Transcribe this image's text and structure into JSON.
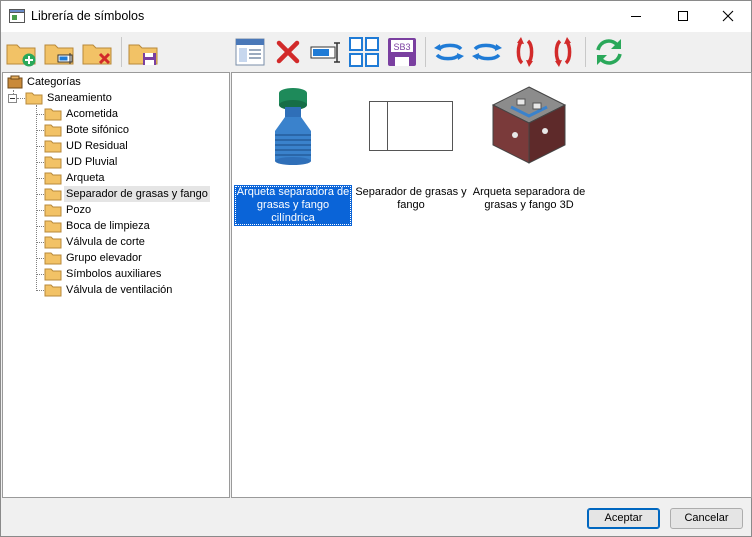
{
  "window": {
    "title": "Librería de símbolos"
  },
  "tree": {
    "root": "Categorías",
    "group": "Saneamiento",
    "items": [
      "Acometida",
      "Bote sifónico",
      "UD Residual",
      "UD Pluvial",
      "Arqueta",
      "Separador de grasas y fango",
      "Pozo",
      "Boca de limpieza",
      "Válvula de corte",
      "Grupo elevador",
      "Símbolos auxiliares",
      "Válvula de ventilación"
    ],
    "selected_index": 5
  },
  "symbols": [
    {
      "caption": "Arqueta separadora de grasas y fango cilíndrica",
      "icon": "cylindrical-separator-icon",
      "selected": true
    },
    {
      "caption": "Separador de grasas y fango",
      "icon": "separator-2d-icon",
      "selected": false
    },
    {
      "caption": "Arqueta separadora de grasas y fango 3D",
      "icon": "separator-3d-icon",
      "selected": false
    }
  ],
  "toolbar": {
    "icons": [
      "new-folder-icon",
      "edit-folder-icon",
      "delete-folder-icon",
      "save-folder-icon",
      "properties-icon",
      "delete-icon",
      "rename-icon",
      "grid-view-icon",
      "sb3-save-icon",
      "rotate-left-icon",
      "rotate-right-icon",
      "flip-vertical-icon",
      "flip-vertical-alt-icon",
      "refresh-icon"
    ],
    "sb3_label": "SB3"
  },
  "buttons": {
    "ok": "Aceptar",
    "cancel": "Cancelar"
  },
  "colors": {
    "selection": "#0a64d8",
    "folder": "#f2c266",
    "accent_blue": "#1f7bd6",
    "accent_red": "#d22a2a",
    "accent_green": "#2aa85a"
  }
}
